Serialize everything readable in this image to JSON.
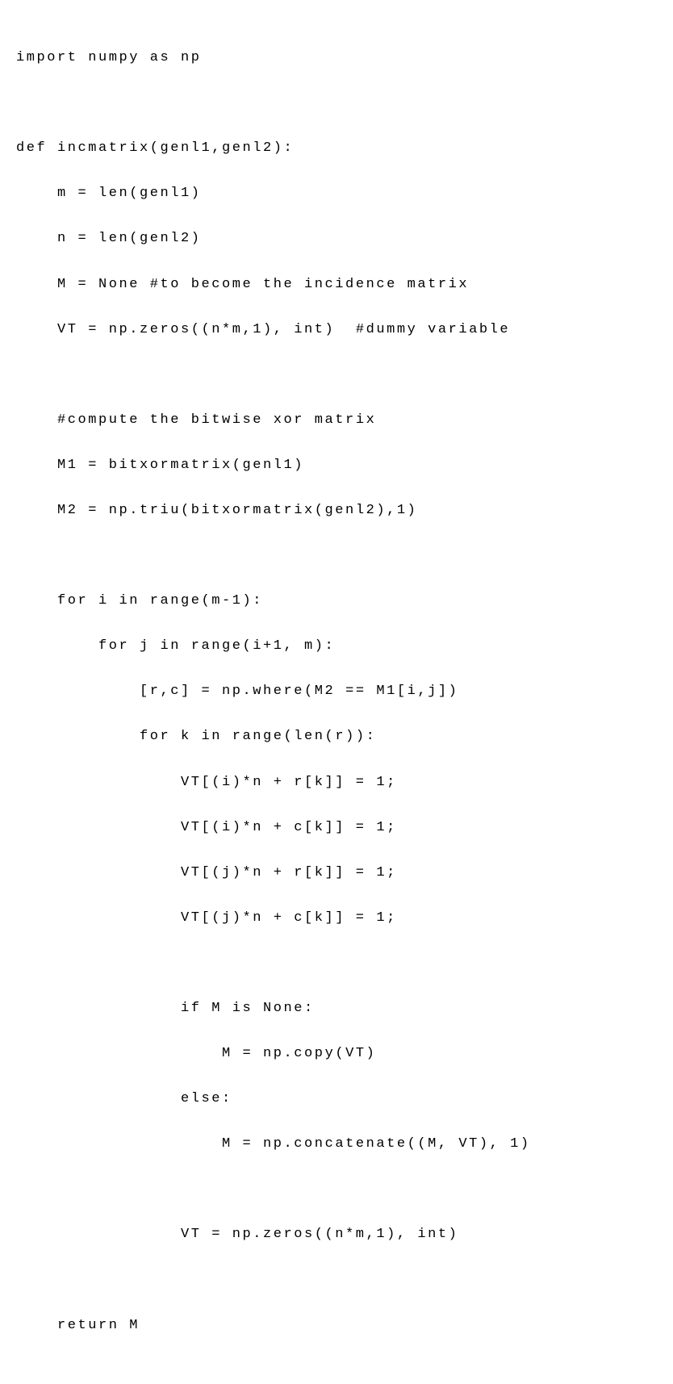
{
  "code": {
    "lines": [
      {
        "text": "import numpy as np",
        "indent": 0
      },
      {
        "text": "",
        "indent": 0
      },
      {
        "text": "def incmatrix(genl1,genl2):",
        "indent": 0
      },
      {
        "text": "m = len(genl1)",
        "indent": 1
      },
      {
        "text": "n = len(genl2)",
        "indent": 1
      },
      {
        "text": "M = None #to become the incidence matrix",
        "indent": 1
      },
      {
        "text": "VT = np.zeros((n*m,1), int)  #dummy variable",
        "indent": 1
      },
      {
        "text": "",
        "indent": 0
      },
      {
        "text": "#compute the bitwise xor matrix",
        "indent": 1
      },
      {
        "text": "M1 = bitxormatrix(genl1)",
        "indent": 1
      },
      {
        "text": "M2 = np.triu(bitxormatrix(genl2),1)",
        "indent": 1
      },
      {
        "text": "",
        "indent": 0
      },
      {
        "text": "for i in range(m-1):",
        "indent": 1
      },
      {
        "text": "for j in range(i+1, m):",
        "indent": 2
      },
      {
        "text": "[r,c] = np.where(M2 == M1[i,j])",
        "indent": 3
      },
      {
        "text": "for k in range(len(r)):",
        "indent": 3
      },
      {
        "text": "VT[(i)*n + r[k]] = 1;",
        "indent": 4
      },
      {
        "text": "VT[(i)*n + c[k]] = 1;",
        "indent": 4
      },
      {
        "text": "VT[(j)*n + r[k]] = 1;",
        "indent": 4
      },
      {
        "text": "VT[(j)*n + c[k]] = 1;",
        "indent": 4
      },
      {
        "text": "",
        "indent": 0
      },
      {
        "text": "if M is None:",
        "indent": 4
      },
      {
        "text": "M = np.copy(VT)",
        "indent": 5
      },
      {
        "text": "else:",
        "indent": 4
      },
      {
        "text": "M = np.concatenate((M, VT), 1)",
        "indent": 5
      },
      {
        "text": "",
        "indent": 0
      },
      {
        "text": "VT = np.zeros((n*m,1), int)",
        "indent": 4
      },
      {
        "text": "",
        "indent": 0
      },
      {
        "text": "return M",
        "indent": 1
      }
    ]
  }
}
